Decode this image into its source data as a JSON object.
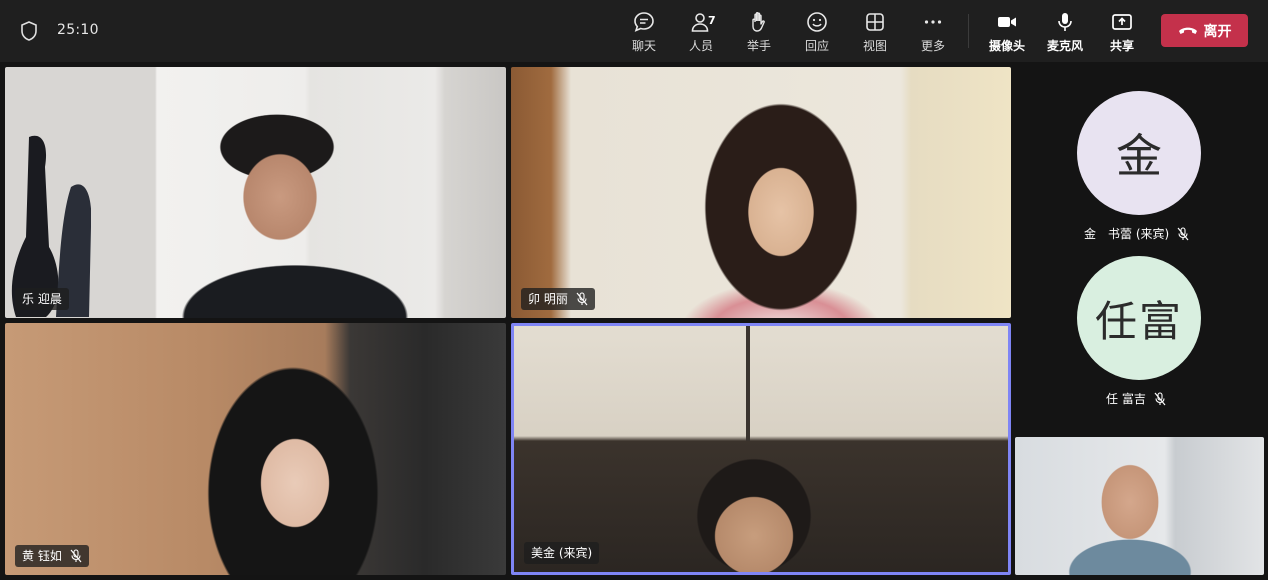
{
  "meeting": {
    "timer": "25:10"
  },
  "toolbar": {
    "chat": "聊天",
    "people": "人员",
    "people_count": "7",
    "raise_hand": "举手",
    "react": "回应",
    "view": "视图",
    "more": "更多",
    "camera": "摄像头",
    "mic": "麦克风",
    "share": "共享",
    "leave": "离开"
  },
  "tiles": [
    {
      "name": "乐 迎晨",
      "muted": false
    },
    {
      "name": "卯 明丽",
      "muted": true
    },
    {
      "name": "黄 钰如",
      "muted": true
    },
    {
      "name": "美金 (来宾)",
      "muted": false,
      "active": true
    }
  ],
  "avatars": [
    {
      "initials": "金",
      "name": "金　书蕾 (来宾)",
      "muted": true
    },
    {
      "initials": "任富",
      "name": "任 富吉",
      "muted": true
    }
  ],
  "colors": {
    "leave": "#c4314b",
    "active_border": "#7f85f5",
    "topbar": "#1f1f1f"
  },
  "icons": [
    "shield-icon",
    "chat-icon",
    "people-icon",
    "hand-icon",
    "smile-icon",
    "grid-icon",
    "more-icon",
    "camera-icon",
    "mic-icon",
    "share-icon",
    "phone-icon",
    "mic-off-icon"
  ]
}
